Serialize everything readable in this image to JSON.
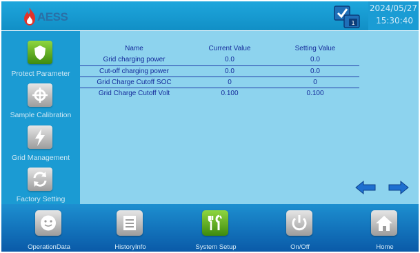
{
  "header": {
    "brand": "AESS",
    "date": "2024/05/27",
    "time": "15:30:40",
    "screen_badge": "1",
    "icons": {
      "logo": "flame-logo-icon",
      "screen": "screen-switch-icon"
    }
  },
  "sidebar": {
    "items": [
      {
        "label": "Protect Parameter",
        "icon": "shield-icon",
        "active": true
      },
      {
        "label": "Sample Calibration",
        "icon": "crosshair-icon",
        "active": false
      },
      {
        "label": "Grid Management",
        "icon": "lightning-icon",
        "active": false
      },
      {
        "label": "Factory Setting",
        "icon": "refresh-icon",
        "active": false
      }
    ]
  },
  "table": {
    "headers": [
      "Name",
      "Current Value",
      "Setting Value"
    ],
    "rows": [
      {
        "name": "Grid charging power",
        "current": "0.0",
        "setting": "0.0"
      },
      {
        "name": "Cut-off charging power",
        "current": "0.0",
        "setting": "0.0"
      },
      {
        "name": "Grid Charge Cutoff SOC",
        "current": "0",
        "setting": "0"
      },
      {
        "name": "Grid Charge Cutoff Volt",
        "current": "0.100",
        "setting": "0.100"
      }
    ]
  },
  "nav_arrows": {
    "prev": "arrow-left-icon",
    "next": "arrow-right-icon"
  },
  "bottom": {
    "items": [
      {
        "label": "OperationData",
        "icon": "smiley-icon",
        "active": false
      },
      {
        "label": "HistoryInfo",
        "icon": "list-icon",
        "active": false
      },
      {
        "label": "System Setup",
        "icon": "tools-icon",
        "active": true
      },
      {
        "label": "On/Off",
        "icon": "power-icon",
        "active": false
      },
      {
        "label": "Home",
        "icon": "home-icon",
        "active": false
      }
    ]
  },
  "colors": {
    "header": "#1ea6dc",
    "sidebar": "#1b9bd3",
    "main": "#8dd3ee",
    "bottom": "#0a5aa8",
    "accent_green": "#5fb41f",
    "table_text": "#142a9a",
    "logo_red": "#e1332a"
  }
}
